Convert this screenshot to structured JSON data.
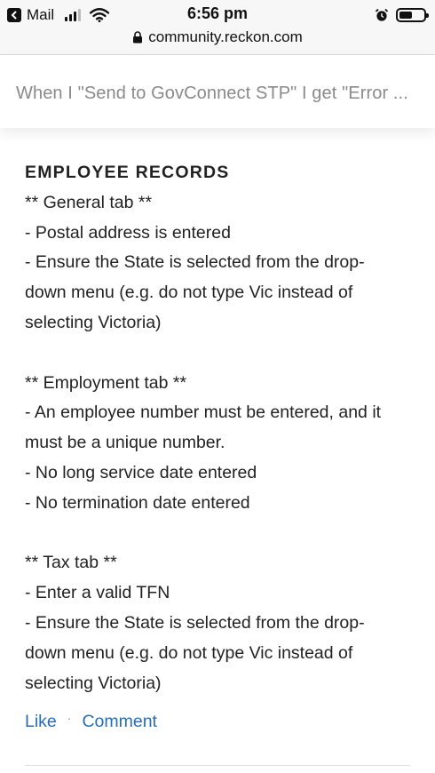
{
  "status_bar": {
    "back_app": "Mail",
    "time": "6:56 pm",
    "icons": [
      "back-arrow-icon",
      "signal-icon",
      "wifi-icon",
      "alarm-icon",
      "battery-icon"
    ]
  },
  "url_bar": {
    "url": "community.reckon.com",
    "icon": "lock-icon"
  },
  "page_title": "When I \"Send to GovConnect STP\" I get \"Error ...",
  "content": {
    "heading": "EMPLOYEE RECORDS",
    "general_tab": {
      "title": "** General tab **",
      "lines": [
        "- Postal address is entered",
        "- Ensure the State is selected from the drop-",
        "down menu (e.g. do not type Vic instead of",
        "selecting Victoria)"
      ]
    },
    "employment_tab": {
      "title": "** Employment tab **",
      "lines": [
        "- An employee number must be entered, and it",
        "must be a unique number.",
        "- No long service date entered",
        "- No termination date entered"
      ]
    },
    "tax_tab": {
      "title": "** Tax tab **",
      "lines": [
        "- Enter a valid TFN",
        "- Ensure the State is selected from the drop-",
        "down menu (e.g. do not type Vic instead of",
        "selecting Victoria)"
      ]
    }
  },
  "actions": {
    "like": "Like",
    "separator": "·",
    "comment": "Comment"
  },
  "colors": {
    "link": "#2a6db1",
    "title_gray": "#8a8a8a",
    "text": "#222222"
  }
}
